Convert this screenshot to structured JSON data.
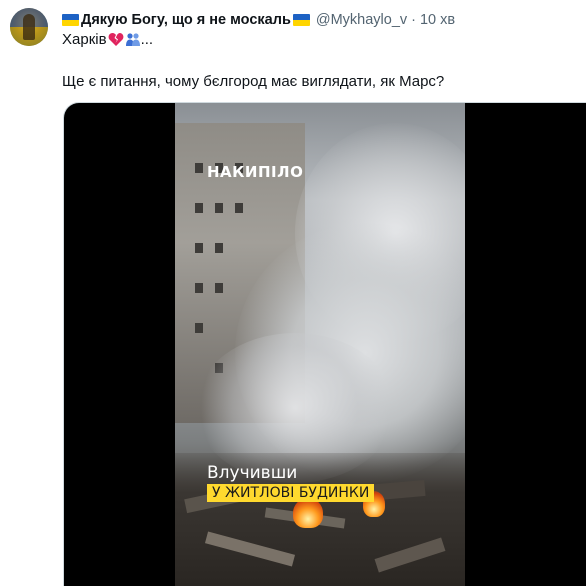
{
  "tweet": {
    "display_name": "Дякую Богу, що я не москаль",
    "handle": "@Mykhaylo_v",
    "separator": "·",
    "time": "10 хв",
    "text_line1": "Харків",
    "text_line1_suffix": "...",
    "text_line2": "Ще є питання, чому бєлгород має виглядати, як Марс?",
    "emoji": [
      "broken-heart-icon",
      "people-hugging-icon"
    ],
    "flag_colors": {
      "blue": "#1d62c4",
      "yellow": "#ffd500"
    }
  },
  "media": {
    "watermark": "НАКИПІЛО",
    "caption_line1": "Влучивши",
    "caption_line2": "У ЖИТЛОВІ БУДИНКИ",
    "caption_highlight_color": "#ffd92e"
  }
}
